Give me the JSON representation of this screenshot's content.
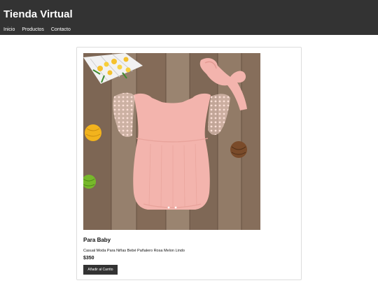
{
  "header": {
    "title": "Tienda Virtual",
    "nav": [
      "Inicio",
      "Productos",
      "Contacto"
    ]
  },
  "product": {
    "name": "Para Baby",
    "description": "Casual Moda Para Niñas Bebé Pañalero Rosa Melon Lindo",
    "price": "$350",
    "add_to_cart_label": "Añadir al Carrito"
  },
  "colors": {
    "header_bg": "#333333",
    "header_text": "#ffffff",
    "button_bg": "#333333",
    "card_border": "#dddddd",
    "romper_pink": "#f3b4ad",
    "wood_background": "#8a7260"
  }
}
